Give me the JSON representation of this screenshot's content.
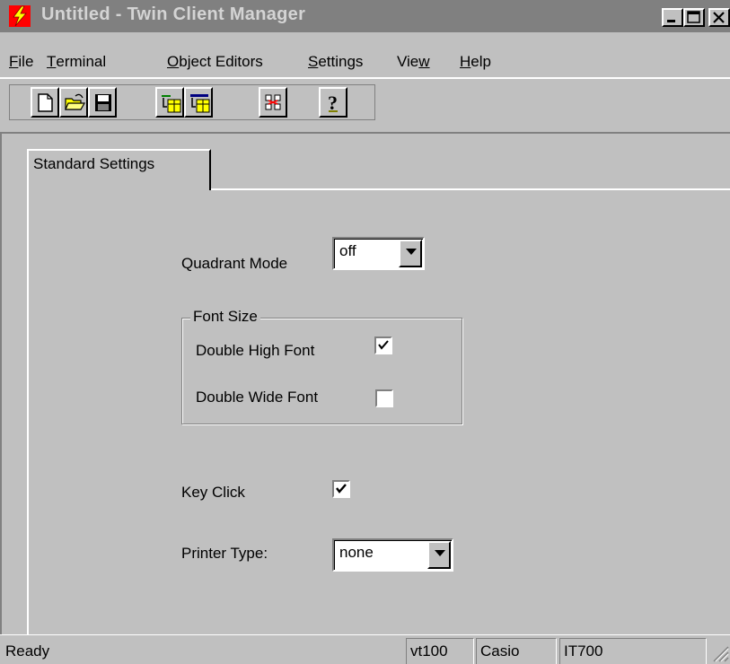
{
  "window": {
    "title": "Untitled - Twin Client Manager",
    "icon": "lightning-icon",
    "controls": [
      "minimize-icon",
      "maximize-icon",
      "close-icon"
    ]
  },
  "menu": [
    {
      "label": "File",
      "mnemonic": "F",
      "rest": "ile"
    },
    {
      "label": "Terminal",
      "mnemonic": "T",
      "rest": "erminal"
    },
    {
      "label": "Object Editors",
      "mnemonic": "O",
      "rest": "bject Editors"
    },
    {
      "label": "Settings",
      "mnemonic": "S",
      "rest": "ettings"
    },
    {
      "label": "View",
      "pre": "Vie",
      "mnemonic": "w"
    },
    {
      "label": "Help",
      "mnemonic": "H",
      "rest": "elp"
    }
  ],
  "toolbar": [
    "new-file-icon",
    "open-folder-icon",
    "save-icon",
    "object-editor-icon",
    "object-import-icon",
    "settings-grid-icon",
    "help-icon"
  ],
  "tab": {
    "label": "Standard Settings"
  },
  "settings": {
    "quadrant_mode": {
      "label": "Quadrant Mode",
      "value": "off"
    },
    "font_size": {
      "label": "Font Size",
      "double_high": {
        "label": "Double High Font",
        "checked": true
      },
      "double_wide": {
        "label": "Double Wide Font",
        "checked": false
      }
    },
    "key_click": {
      "label": "Key Click",
      "checked": true
    },
    "printer_type": {
      "label": "Printer Type:",
      "value": "none"
    }
  },
  "status": {
    "message": "Ready",
    "terminal": "vt100",
    "vendor": "Casio",
    "model": "IT700"
  }
}
